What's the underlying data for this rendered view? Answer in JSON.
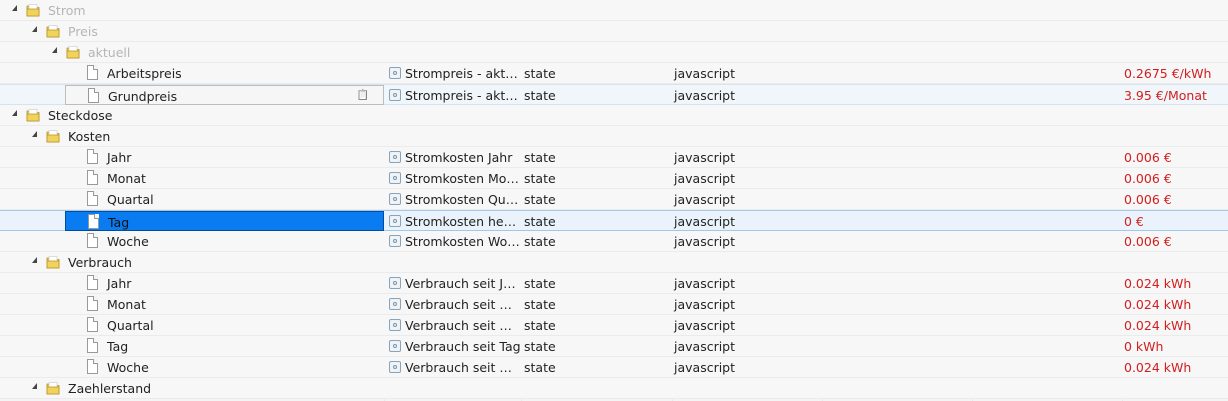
{
  "tree": [
    {
      "label": "Strom",
      "level": 0,
      "kind": "folder",
      "dim": true
    },
    {
      "label": "Preis",
      "level": 1,
      "kind": "folder",
      "dim": true
    },
    {
      "label": "aktuell",
      "level": 2,
      "kind": "folder",
      "dim": true
    },
    {
      "label": "Arbeitspreis",
      "level": 3,
      "kind": "state",
      "desc": "Strompreis - aktuell Arbeitspreis",
      "role": "state",
      "adapter": "javascript",
      "value": "0.2675 €/kWh"
    },
    {
      "label": "Grundpreis",
      "level": 3,
      "kind": "state",
      "desc": "Strompreis - aktuell Grundpreis",
      "role": "state",
      "adapter": "javascript",
      "value": "3.95 €/Monat",
      "hover": true
    },
    {
      "label": "Steckdose",
      "level": 0,
      "kind": "folder"
    },
    {
      "label": "Kosten",
      "level": 1,
      "kind": "folder"
    },
    {
      "label": "Jahr",
      "level": 3,
      "kind": "state",
      "desc": "Stromkosten Jahr",
      "role": "state",
      "adapter": "javascript",
      "value": "0.006 €"
    },
    {
      "label": "Monat",
      "level": 3,
      "kind": "state",
      "desc": "Stromkosten Monat",
      "role": "state",
      "adapter": "javascript",
      "value": "0.006 €"
    },
    {
      "label": "Quartal",
      "level": 3,
      "kind": "state",
      "desc": "Stromkosten Quartal",
      "role": "state",
      "adapter": "javascript",
      "value": "0.006 €"
    },
    {
      "label": "Tag",
      "level": 3,
      "kind": "state",
      "desc": "Stromkosten heute",
      "role": "state",
      "adapter": "javascript",
      "value": "0 €",
      "selected": true
    },
    {
      "label": "Woche",
      "level": 3,
      "kind": "state",
      "desc": "Stromkosten Woche",
      "role": "state",
      "adapter": "javascript",
      "value": "0.006 €"
    },
    {
      "label": "Verbrauch",
      "level": 1,
      "kind": "folder"
    },
    {
      "label": "Jahr",
      "level": 3,
      "kind": "state",
      "desc": "Verbrauch seit Jahr",
      "role": "state",
      "adapter": "javascript",
      "value": "0.024 kWh"
    },
    {
      "label": "Monat",
      "level": 3,
      "kind": "state",
      "desc": "Verbrauch seit Monat",
      "role": "state",
      "adapter": "javascript",
      "value": "0.024 kWh"
    },
    {
      "label": "Quartal",
      "level": 3,
      "kind": "state",
      "desc": "Verbrauch seit Quartal",
      "role": "state",
      "adapter": "javascript",
      "value": "0.024 kWh"
    },
    {
      "label": "Tag",
      "level": 3,
      "kind": "state",
      "desc": "Verbrauch seit Tag",
      "role": "state",
      "adapter": "javascript",
      "value": "0 kWh"
    },
    {
      "label": "Woche",
      "level": 3,
      "kind": "state",
      "desc": "Verbrauch seit Woche",
      "role": "state",
      "adapter": "javascript",
      "value": "0.024 kWh"
    },
    {
      "label": "Zaehlerstand",
      "level": 1,
      "kind": "folder"
    }
  ],
  "icons": {
    "toggle": "expanded-triangle-icon",
    "folder": "folder-icon",
    "file": "file-icon",
    "type": "state-type-icon",
    "clipboard": "clipboard-icon"
  },
  "colors": {
    "value": "#d21e1e",
    "selection": "#0a7cf2",
    "folder": "#e7c43a"
  }
}
